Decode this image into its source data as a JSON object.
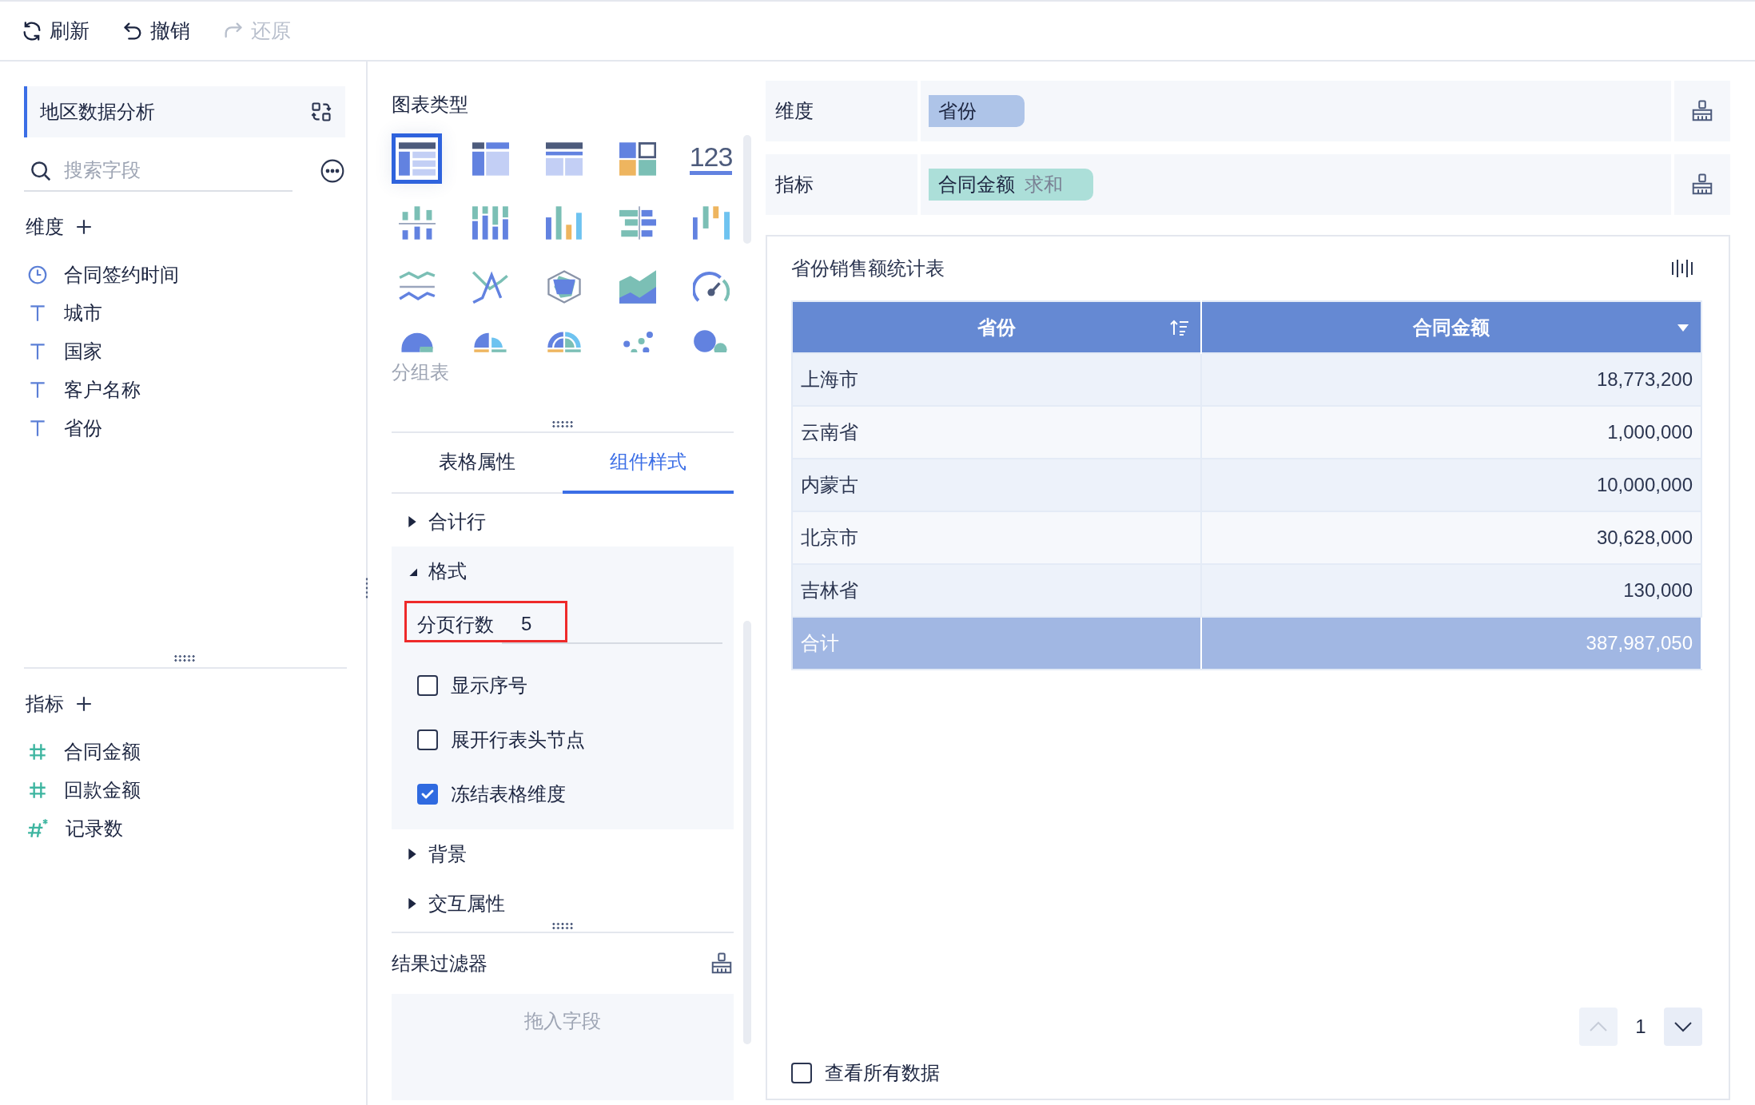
{
  "toolbar": [
    {
      "kind": "refresh",
      "label": "刷新",
      "disabled": false
    },
    {
      "kind": "undo",
      "label": "撤销",
      "disabled": false
    },
    {
      "kind": "redo",
      "label": "还原",
      "disabled": true
    }
  ],
  "fields_panel": {
    "title": "地区数据分析",
    "search": {
      "placeholder": "搜索字段"
    },
    "dimensions": {
      "label": "维度",
      "items": [
        {
          "kind": "time",
          "name": "合同签约时间"
        },
        {
          "kind": "text",
          "name": "城市"
        },
        {
          "kind": "text",
          "name": "国家"
        },
        {
          "kind": "text",
          "name": "客户名称"
        },
        {
          "kind": "text",
          "name": "省份"
        }
      ]
    },
    "measures": {
      "label": "指标",
      "items": [
        {
          "kind": "number",
          "name": "合同金额"
        },
        {
          "kind": "number",
          "name": "回款金额"
        },
        {
          "kind": "count",
          "name": "记录数"
        }
      ]
    }
  },
  "chart_types": {
    "title": "图表类型",
    "hint": "分组表",
    "types": [
      {
        "kind": "table",
        "selected": true
      },
      {
        "kind": "cross",
        "selected": false
      },
      {
        "kind": "detail",
        "selected": false
      },
      {
        "kind": "dashboard",
        "selected": false
      },
      {
        "kind": "kpi",
        "glyph": "123",
        "selected": false
      },
      {
        "kind": "diverging",
        "selected": false
      },
      {
        "kind": "stacked",
        "selected": false
      },
      {
        "kind": "bars",
        "selected": false
      },
      {
        "kind": "butterfly",
        "selected": false
      },
      {
        "kind": "waterfall",
        "selected": false
      },
      {
        "kind": "waves",
        "selected": false
      },
      {
        "kind": "lines",
        "selected": false
      },
      {
        "kind": "radar",
        "selected": false
      },
      {
        "kind": "area",
        "selected": false
      },
      {
        "kind": "gauge",
        "selected": false
      },
      {
        "kind": "pie",
        "selected": false
      },
      {
        "kind": "quarter",
        "selected": false
      },
      {
        "kind": "rose",
        "selected": false
      },
      {
        "kind": "scatter",
        "selected": false
      },
      {
        "kind": "bubble",
        "selected": false
      }
    ]
  },
  "tabs": [
    {
      "label": "表格属性",
      "selected": false
    },
    {
      "label": "组件样式",
      "selected": true
    }
  ],
  "sections": [
    {
      "label": "合计行",
      "expanded": false
    },
    {
      "label": "格式",
      "expanded": true,
      "page_rows": {
        "label": "分页行数",
        "value": "5"
      },
      "options": [
        {
          "label": "显示序号",
          "checked": false
        },
        {
          "label": "展开行表头节点",
          "checked": false
        },
        {
          "label": "冻结表格维度",
          "checked": true
        }
      ]
    },
    {
      "label": "背景",
      "expanded": false
    },
    {
      "label": "交互属性",
      "expanded": false
    }
  ],
  "result_filter": {
    "title": "结果过滤器",
    "hint": "拖入字段"
  },
  "shelves": [
    {
      "label": "维度",
      "pills": [
        {
          "kind": "dimension",
          "name": "省份"
        }
      ]
    },
    {
      "label": "指标",
      "pills": [
        {
          "kind": "measure",
          "name": "合同金额",
          "aggregation": "求和"
        }
      ]
    }
  ],
  "table_card": {
    "title": "省份销售额统计表",
    "columns": [
      {
        "label": "省份",
        "kind": "sort"
      },
      {
        "label": "合同金额",
        "kind": "menu"
      }
    ],
    "rows": [
      [
        "上海市",
        "18,773,200"
      ],
      [
        "云南省",
        "1,000,000"
      ],
      [
        "内蒙古",
        "10,000,000"
      ],
      [
        "北京市",
        "30,628,000"
      ],
      [
        "吉林省",
        "130,000"
      ]
    ],
    "total": [
      "合计",
      "387,987,050"
    ],
    "pagination": {
      "page": "1",
      "prev_disabled": true,
      "next_disabled": false
    },
    "view_all": {
      "label": "查看所有数据",
      "checked": false
    }
  }
}
